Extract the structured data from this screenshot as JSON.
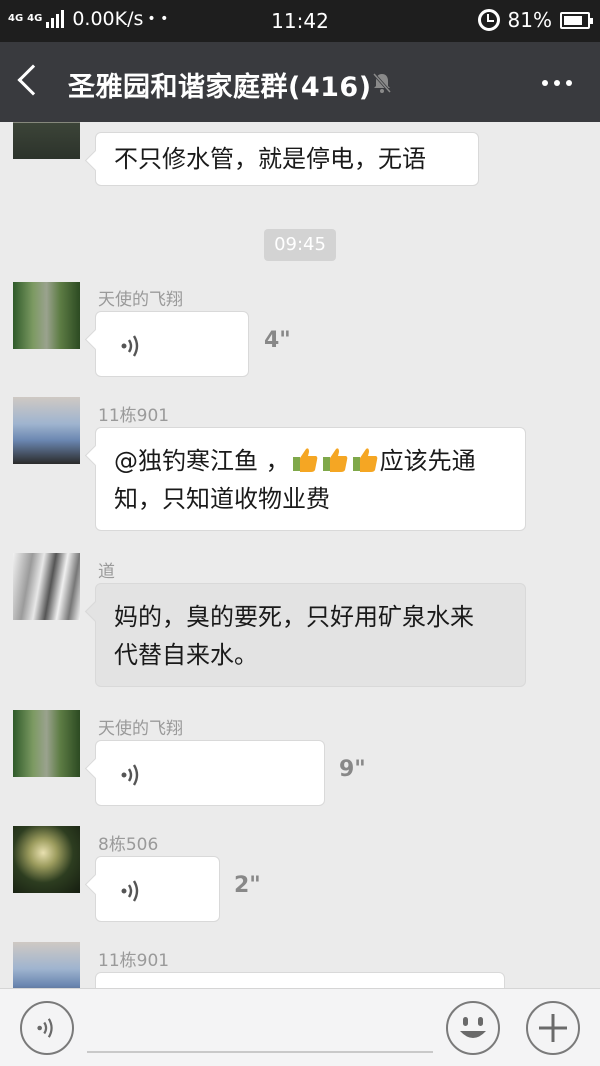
{
  "status": {
    "network": "4G",
    "network2": "4G",
    "speed": "0.00K/s",
    "dots": "• •",
    "time": "11:42",
    "battery": "81%",
    "battery_level": 0.81
  },
  "header": {
    "title": "圣雅园和谐家庭群(416)"
  },
  "messages": {
    "m0": {
      "text": "不只修水管，就是停电，无语"
    },
    "time_divider": "09:45",
    "m1": {
      "sender": "天使的飞翔",
      "duration": "4\""
    },
    "m2": {
      "sender": "11栋901",
      "text_a": "@独钓寒江鱼 ，",
      "text_b": "应该先通",
      "text_c": "知，只知道收物业费"
    },
    "m3": {
      "sender": "道",
      "line1": "妈的，臭的要死，只好用矿泉水来",
      "line2": "代替自来水。"
    },
    "m4": {
      "sender": "天使的飞翔",
      "duration": "9\""
    },
    "m5": {
      "sender": "8栋506",
      "duration": "2\""
    },
    "m6": {
      "sender": "11栋901"
    }
  },
  "icons": {
    "back": "chevron-left-icon",
    "mute": "bell-off-icon",
    "more": "more-dots-icon",
    "voice": "voice-wave-icon",
    "emoji": "emoji-icon",
    "plus": "plus-icon",
    "thumbs": "thumbs-up-emoji"
  },
  "colors": {
    "titlebar": "#393a3e",
    "background": "#ebebeb",
    "bubble": "#ffffff"
  }
}
